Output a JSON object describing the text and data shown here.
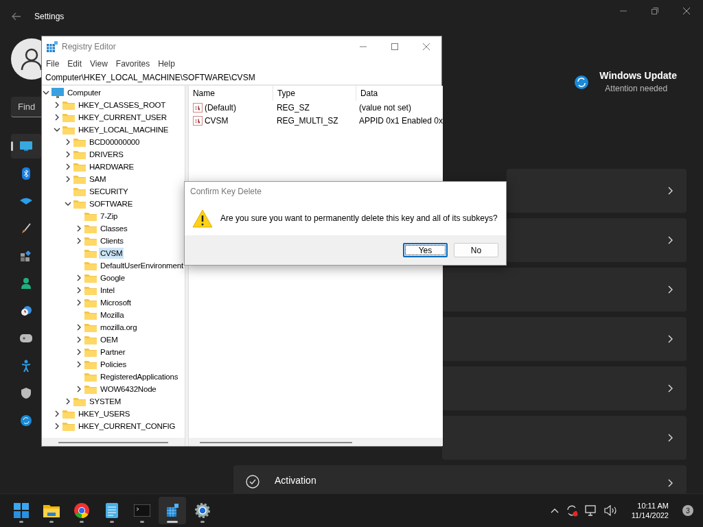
{
  "settings": {
    "title": "Settings",
    "search": {
      "placeholder": "Find"
    },
    "nav": [
      {
        "kind": "display",
        "selected": true
      },
      {
        "kind": "bluetooth",
        "selected": false
      },
      {
        "kind": "wifi",
        "selected": false
      },
      {
        "kind": "brush",
        "selected": false
      },
      {
        "kind": "apps",
        "selected": false
      },
      {
        "kind": "person",
        "selected": false
      },
      {
        "kind": "clock",
        "selected": false
      },
      {
        "kind": "gamepad",
        "selected": false
      },
      {
        "kind": "accessibility",
        "selected": false
      },
      {
        "kind": "shield",
        "selected": false
      },
      {
        "kind": "update",
        "selected": false
      }
    ],
    "update": {
      "title": "Windows Update",
      "status": "Attention needed"
    },
    "cards": [
      {
        "kind": "blank"
      },
      {
        "kind": "blank"
      },
      {
        "kind": "blank"
      },
      {
        "kind": "blank"
      },
      {
        "kind": "blank"
      },
      {
        "kind": "blank"
      },
      {
        "kind": "activation",
        "title": "Activation"
      }
    ]
  },
  "registry_editor": {
    "title": "Registry Editor",
    "menu": [
      "File",
      "Edit",
      "View",
      "Favorites",
      "Help"
    ],
    "address": "Computer\\HKEY_LOCAL_MACHINE\\SOFTWARE\\CVSM",
    "tree": [
      {
        "label": "Computer",
        "kind": "computer",
        "has_subkeys": true,
        "expanded": true,
        "selected": false,
        "children": [
          {
            "label": "HKEY_CLASSES_ROOT",
            "has_subkeys": true,
            "expanded": false,
            "selected": false
          },
          {
            "label": "HKEY_CURRENT_USER",
            "has_subkeys": true,
            "expanded": false,
            "selected": false
          },
          {
            "label": "HKEY_LOCAL_MACHINE",
            "has_subkeys": true,
            "expanded": true,
            "selected": false,
            "children": [
              {
                "label": "BCD00000000",
                "has_subkeys": true,
                "expanded": false,
                "selected": false
              },
              {
                "label": "DRIVERS",
                "has_subkeys": true,
                "expanded": false,
                "selected": false
              },
              {
                "label": "HARDWARE",
                "has_subkeys": true,
                "expanded": false,
                "selected": false
              },
              {
                "label": "SAM",
                "has_subkeys": true,
                "expanded": false,
                "selected": false
              },
              {
                "label": "SECURITY",
                "has_subkeys": false,
                "expanded": false,
                "selected": false
              },
              {
                "label": "SOFTWARE",
                "has_subkeys": true,
                "expanded": true,
                "selected": false,
                "children": [
                  {
                    "label": "7-Zip",
                    "has_subkeys": false,
                    "expanded": false,
                    "selected": false
                  },
                  {
                    "label": "Classes",
                    "has_subkeys": true,
                    "expanded": false,
                    "selected": false
                  },
                  {
                    "label": "Clients",
                    "has_subkeys": true,
                    "expanded": false,
                    "selected": false
                  },
                  {
                    "label": "CVSM",
                    "has_subkeys": false,
                    "expanded": false,
                    "selected": true
                  },
                  {
                    "label": "DefaultUserEnvironment",
                    "has_subkeys": false,
                    "expanded": false,
                    "selected": false
                  },
                  {
                    "label": "Google",
                    "has_subkeys": true,
                    "expanded": false,
                    "selected": false
                  },
                  {
                    "label": "Intel",
                    "has_subkeys": true,
                    "expanded": false,
                    "selected": false
                  },
                  {
                    "label": "Microsoft",
                    "has_subkeys": true,
                    "expanded": false,
                    "selected": false
                  },
                  {
                    "label": "Mozilla",
                    "has_subkeys": false,
                    "expanded": false,
                    "selected": false
                  },
                  {
                    "label": "mozilla.org",
                    "has_subkeys": true,
                    "expanded": false,
                    "selected": false
                  },
                  {
                    "label": "OEM",
                    "has_subkeys": true,
                    "expanded": false,
                    "selected": false
                  },
                  {
                    "label": "Partner",
                    "has_subkeys": true,
                    "expanded": false,
                    "selected": false
                  },
                  {
                    "label": "Policies",
                    "has_subkeys": true,
                    "expanded": false,
                    "selected": false
                  },
                  {
                    "label": "RegisteredApplications",
                    "has_subkeys": false,
                    "expanded": false,
                    "selected": false
                  },
                  {
                    "label": "WOW6432Node",
                    "has_subkeys": true,
                    "expanded": false,
                    "selected": false
                  }
                ]
              },
              {
                "label": "SYSTEM",
                "has_subkeys": true,
                "expanded": false,
                "selected": false
              }
            ]
          },
          {
            "label": "HKEY_USERS",
            "has_subkeys": true,
            "expanded": false,
            "selected": false
          },
          {
            "label": "HKEY_CURRENT_CONFIG",
            "has_subkeys": true,
            "expanded": false,
            "selected": false
          }
        ]
      }
    ],
    "columns": [
      "Name",
      "Type",
      "Data"
    ],
    "values": [
      {
        "name": "(Default)",
        "type": "REG_SZ",
        "data": "(value not set)"
      },
      {
        "name": "CVSM",
        "type": "REG_MULTI_SZ",
        "data": "APPID 0x1 Enabled 0x"
      }
    ]
  },
  "dialog": {
    "title": "Confirm Key Delete",
    "message": "Are you sure you want to permanently delete this key and all of its subkeys?",
    "buttons": [
      {
        "label": "Yes",
        "default": true
      },
      {
        "label": "No",
        "default": false
      }
    ]
  },
  "taskbar": {
    "apps": [
      {
        "kind": "start",
        "active": false
      },
      {
        "kind": "folder",
        "active": false
      },
      {
        "kind": "browser",
        "active": false
      },
      {
        "kind": "notepad",
        "active": false
      },
      {
        "kind": "terminal",
        "active": false
      },
      {
        "kind": "regedit",
        "active": true
      },
      {
        "kind": "settings",
        "active": false
      }
    ],
    "time": "10:11 AM",
    "date": "11/14/2022",
    "notifications": "3"
  }
}
